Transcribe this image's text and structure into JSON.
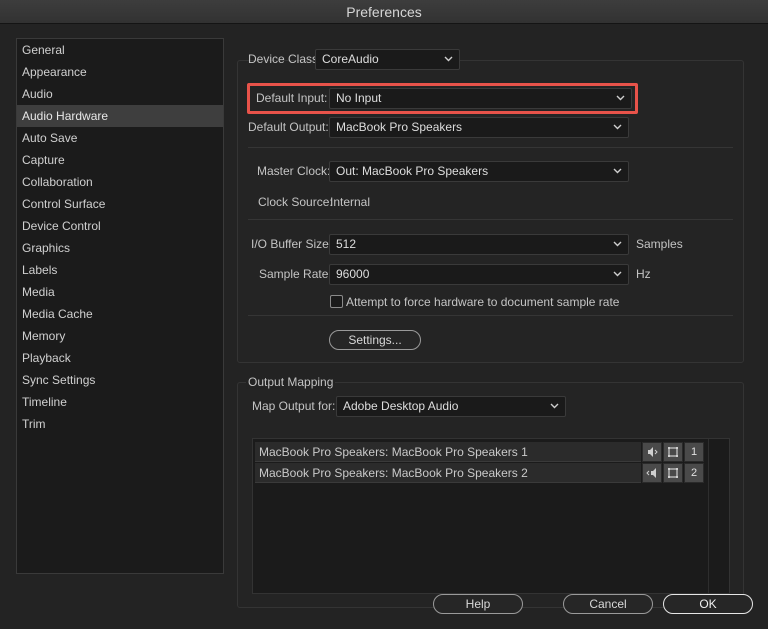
{
  "window": {
    "title": "Preferences"
  },
  "sidebar": {
    "items": [
      {
        "label": "General"
      },
      {
        "label": "Appearance"
      },
      {
        "label": "Audio"
      },
      {
        "label": "Audio Hardware",
        "selected": true
      },
      {
        "label": "Auto Save"
      },
      {
        "label": "Capture"
      },
      {
        "label": "Collaboration"
      },
      {
        "label": "Control Surface"
      },
      {
        "label": "Device Control"
      },
      {
        "label": "Graphics"
      },
      {
        "label": "Labels"
      },
      {
        "label": "Media"
      },
      {
        "label": "Media Cache"
      },
      {
        "label": "Memory"
      },
      {
        "label": "Playback"
      },
      {
        "label": "Sync Settings"
      },
      {
        "label": "Timeline"
      },
      {
        "label": "Trim"
      }
    ]
  },
  "device": {
    "device_class_label": "Device Class:",
    "device_class_value": "CoreAudio",
    "default_input_label": "Default Input:",
    "default_input_value": "No Input",
    "default_output_label": "Default Output:",
    "default_output_value": "MacBook Pro Speakers",
    "master_clock_label": "Master Clock:",
    "master_clock_value": "Out: MacBook Pro Speakers",
    "clock_source_label": "Clock Source:",
    "clock_source_value": "Internal",
    "buffer_size_label": "I/O Buffer Size:",
    "buffer_size_value": "512",
    "buffer_size_unit": "Samples",
    "sample_rate_label": "Sample Rate:",
    "sample_rate_value": "96000",
    "sample_rate_unit": "Hz",
    "force_rate_label": "Attempt to force hardware to document sample rate",
    "force_rate_checked": false,
    "settings_button": "Settings..."
  },
  "output_mapping": {
    "section_title": "Output Mapping",
    "map_output_label": "Map Output for:",
    "map_output_value": "Adobe Desktop Audio",
    "rows": [
      {
        "name": "MacBook Pro Speakers: MacBook Pro Speakers 1",
        "channel": "1"
      },
      {
        "name": "MacBook Pro Speakers: MacBook Pro Speakers 2",
        "channel": "2"
      }
    ]
  },
  "footer": {
    "help": "Help",
    "cancel": "Cancel",
    "ok": "OK"
  },
  "colors": {
    "highlight": "#e8534a",
    "selected_item": "#3e3e3e"
  }
}
